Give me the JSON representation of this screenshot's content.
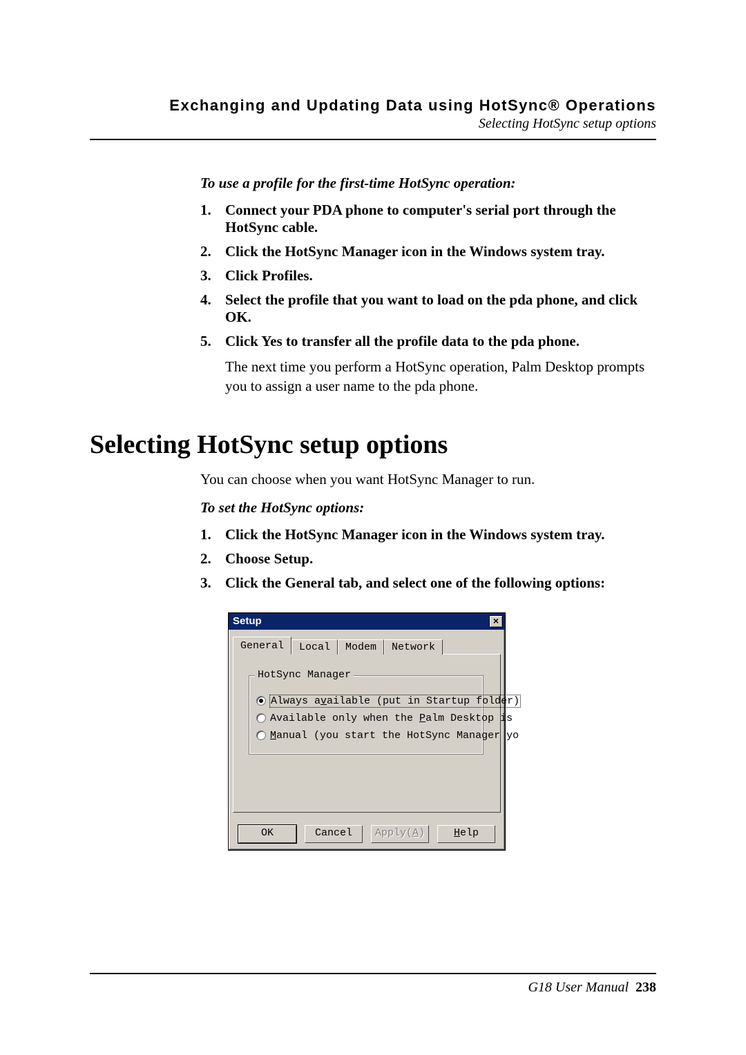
{
  "header": {
    "title": "Exchanging and Updating Data using HotSync® Operations",
    "subtitle": "Selecting HotSync setup options"
  },
  "section1": {
    "intro_italic": "To use a profile for the first-time HotSync operation:",
    "steps": [
      {
        "num": "1.",
        "text": "Connect your PDA phone to computer's serial port through the HotSync cable."
      },
      {
        "num": "2.",
        "text": "Click the HotSync Manager icon in the Windows system tray."
      },
      {
        "num": "3.",
        "text": "Click Profiles."
      },
      {
        "num": "4.",
        "text": "Select the profile that you want to load on the pda phone, and click OK."
      },
      {
        "num": "5.",
        "text": "Click Yes to transfer all the profile data to the pda phone."
      }
    ],
    "followup": "The next time you perform a HotSync operation, Palm Desktop prompts you to assign a user name to the pda phone."
  },
  "heading": "Selecting HotSync setup options",
  "section2": {
    "intro": "You can choose when you want HotSync Manager to run.",
    "sub_italic": "To set the HotSync options:",
    "steps": [
      {
        "num": "1.",
        "text": "Click the HotSync Manager icon in the Windows system tray."
      },
      {
        "num": "2.",
        "text": "Choose Setup."
      },
      {
        "num": "3.",
        "text": "Click the General tab, and select one of the following options:"
      }
    ]
  },
  "dialog": {
    "title": "Setup",
    "tabs": {
      "t1": "General",
      "t2": "Local",
      "t3": "Modem",
      "t4": "Network"
    },
    "group_label": "HotSync Manager",
    "radios": {
      "r1": "Always available (put in Startup folder)",
      "r2": "Available only when the Palm Desktop is",
      "r3": "Manual (you start the HotSync Manager yo"
    },
    "buttons": {
      "ok": "OK",
      "cancel": "Cancel",
      "apply": "Apply(A)",
      "help": "Help"
    }
  },
  "footer": {
    "manual": "G18 User Manual",
    "page": "238"
  }
}
